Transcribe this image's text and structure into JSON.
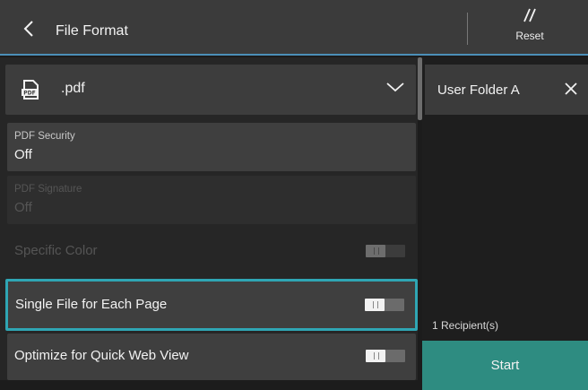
{
  "header": {
    "title": "File Format",
    "back_icon": "chevron-left-icon",
    "reset_label": "Reset",
    "reset_icon": "double-slash-icon"
  },
  "format": {
    "value": ".pdf",
    "icon": "pdf-file-icon",
    "icon_text": "PDF",
    "chevron_icon": "chevron-down-icon"
  },
  "settings": {
    "pdf_security": {
      "label": "PDF Security",
      "value": "Off",
      "enabled": true
    },
    "pdf_signature": {
      "label": "PDF Signature",
      "value": "Off",
      "enabled": false
    },
    "specific_color": {
      "label": "Specific Color",
      "on": false,
      "enabled": false
    },
    "single_file": {
      "label": "Single File for Each Page",
      "on": false,
      "enabled": true,
      "selected": true
    },
    "optimize_web": {
      "label": "Optimize for Quick Web View",
      "on": false,
      "enabled": true
    }
  },
  "recipient": {
    "name": "User Folder A",
    "close_icon": "close-icon",
    "count": "1 Recipient(s)"
  },
  "start": {
    "label": "Start"
  },
  "colors": {
    "accent_border": "#2fa6b4",
    "start_button": "#2e8c81",
    "header_bg": "#3b3b3b"
  }
}
